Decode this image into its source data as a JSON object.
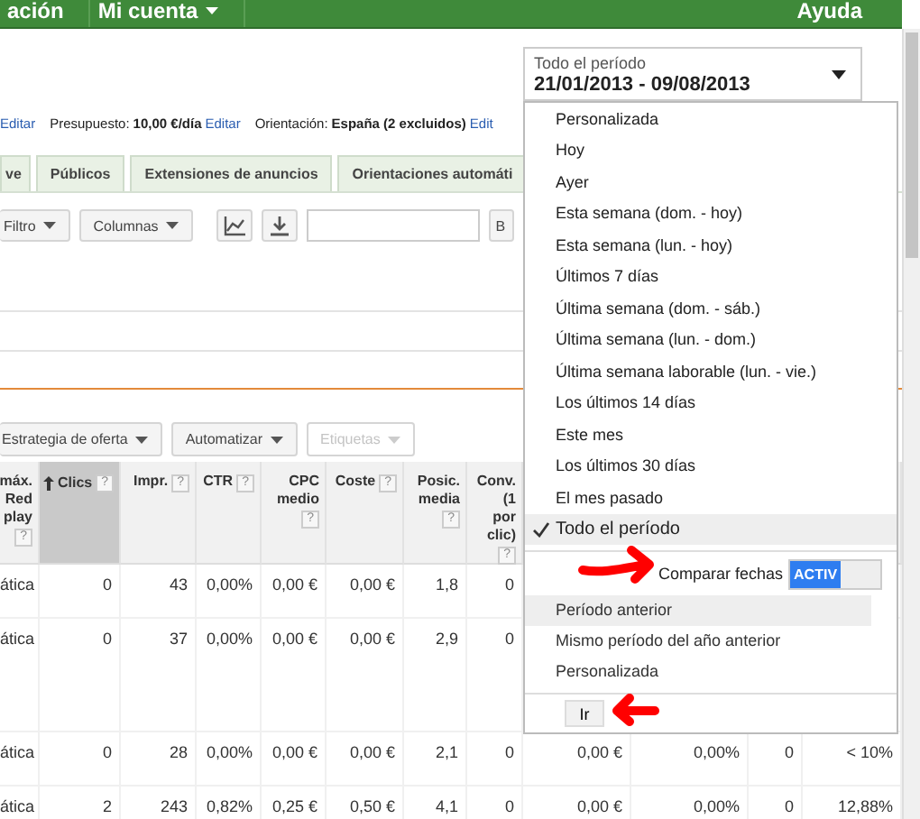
{
  "top_nav": [
    {
      "label": "ación",
      "has_menu": false
    },
    {
      "label": "Mi cuenta",
      "has_menu": true
    }
  ],
  "help_link": "Ayuda",
  "summary": [
    {
      "kind": "link",
      "text": "Editar"
    },
    {
      "kind": "field",
      "label": "Presupuesto:",
      "value": "10,00 €/día"
    },
    {
      "kind": "link",
      "text": "Editar"
    },
    {
      "kind": "field",
      "label": "Orientación:",
      "value": "España (2 excluidos)"
    },
    {
      "kind": "link",
      "text": "Edit"
    }
  ],
  "tabs": [
    {
      "label": "ve",
      "selected": false
    },
    {
      "label": "Públicos",
      "selected": false
    },
    {
      "label": "Extensiones de anuncios",
      "selected": false
    },
    {
      "label": "Orientaciones automáti",
      "selected": false
    }
  ],
  "toolbar": {
    "filter_button": "Filtro",
    "columns_button": "Columnas",
    "search_button": "B"
  },
  "actions": [
    {
      "label": "Estrategia de oferta",
      "disabled": false
    },
    {
      "label": "Automatizar",
      "disabled": false
    },
    {
      "label": "Etiquetas",
      "disabled": true
    }
  ],
  "table": {
    "columns": [
      {
        "label": "máx.\nRed\nplay",
        "help": "?",
        "sorted": false
      },
      {
        "label": "Clics",
        "help": "?",
        "sorted": true
      },
      {
        "label": "Impr.",
        "help": "?",
        "sorted": false
      },
      {
        "label": "CTR",
        "help": "?",
        "sorted": false
      },
      {
        "label": "CPC\nmedio",
        "help": "?",
        "sorted": false
      },
      {
        "label": "Coste",
        "help": "?",
        "sorted": false
      },
      {
        "label": "Posic.\nmedia",
        "help": "?",
        "sorted": false
      },
      {
        "label": "Conv.\n(1\npor\nclic)",
        "help": "?",
        "sorted": false
      }
    ],
    "rows": [
      {
        "cells": [
          "ática",
          "0",
          "43",
          "0,00%",
          "0,00 €",
          "0,00 €",
          "1,8",
          "0"
        ]
      },
      {
        "cells": [
          "ática",
          "0",
          "37",
          "0,00%",
          "0,00 €",
          "0,00 €",
          "2,9",
          "0"
        ]
      },
      {
        "cells": [
          "ática",
          "0",
          "28",
          "0,00%",
          "0,00 €",
          "0,00 €",
          "2,1",
          "0",
          "0,00 €",
          "0,00%",
          "0",
          "< 10%"
        ]
      },
      {
        "cells": [
          "ática",
          "2",
          "243",
          "0,82%",
          "0,25 €",
          "0,50 €",
          "4,1",
          "0",
          "0,00 €",
          "0,00%",
          "0",
          "12,88%"
        ]
      }
    ]
  },
  "date_picker": {
    "preset": "Todo el período",
    "range": "21/01/2013 - 09/08/2013",
    "options": [
      {
        "label": "Personalizada",
        "selected": false
      },
      {
        "label": "Hoy",
        "selected": false
      },
      {
        "label": "Ayer",
        "selected": false
      },
      {
        "label": "Esta semana (dom. - hoy)",
        "selected": false
      },
      {
        "label": "Esta semana (lun. - hoy)",
        "selected": false
      },
      {
        "label": "Últimos 7 días",
        "selected": false
      },
      {
        "label": "Última semana (dom. - sáb.)",
        "selected": false
      },
      {
        "label": "Última semana (lun. - dom.)",
        "selected": false
      },
      {
        "label": "Última semana laborable (lun. - vie.)",
        "selected": false
      },
      {
        "label": "Los últimos 14 días",
        "selected": false
      },
      {
        "label": "Este mes",
        "selected": false
      },
      {
        "label": "Los últimos 30 días",
        "selected": false
      },
      {
        "label": "El mes pasado",
        "selected": false
      },
      {
        "label": "Todo el período",
        "selected": true
      }
    ],
    "compare": {
      "label": "Comparar fechas",
      "on": true,
      "toggle_text": "ACTIV",
      "options": [
        {
          "label": "Período anterior",
          "selected": true
        },
        {
          "label": "Mismo período del año anterior",
          "selected": false
        },
        {
          "label": "Personalizada",
          "selected": false
        }
      ]
    },
    "apply_button": "Ir"
  }
}
